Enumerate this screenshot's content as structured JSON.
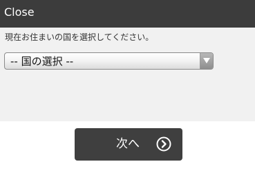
{
  "header": {
    "close_label": "Close"
  },
  "form": {
    "prompt": "現在お住まいの国を選択してください。",
    "country_select": {
      "selected_label": "-- 国の選択 --"
    }
  },
  "actions": {
    "next_label": "次へ",
    "next_icon": "circle-chevron-right-icon"
  },
  "colors": {
    "header_bg": "#3c3c3c",
    "panel_bg": "#f1f1f1",
    "button_bg": "#3f3f3f"
  }
}
